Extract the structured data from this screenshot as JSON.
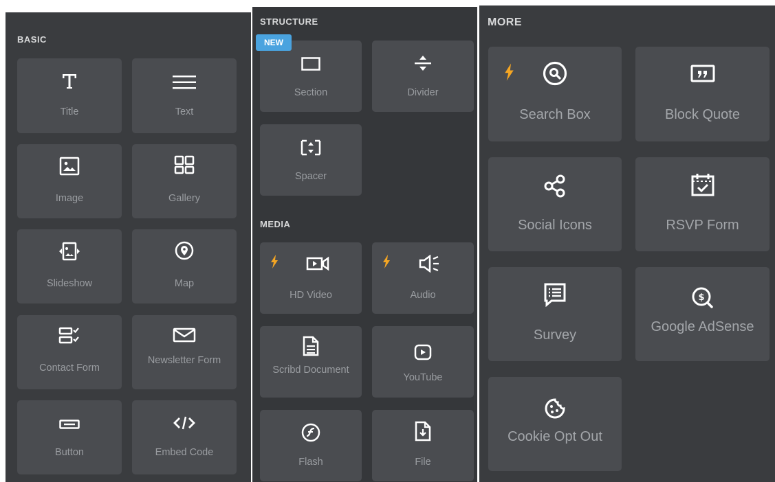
{
  "colors": {
    "panel_bg": "#3a3c3f",
    "tile_bg": "#4a4c50",
    "icon_white": "#ffffff",
    "label_gray": "#9a9da1",
    "bolt_orange": "#f5a623",
    "new_badge_blue": "#4aa3df"
  },
  "basic": {
    "title": "BASIC",
    "items": [
      {
        "label": "Title",
        "icon": "title-icon"
      },
      {
        "label": "Text",
        "icon": "text-icon"
      },
      {
        "label": "Image",
        "icon": "image-icon"
      },
      {
        "label": "Gallery",
        "icon": "gallery-icon"
      },
      {
        "label": "Slideshow",
        "icon": "slideshow-icon"
      },
      {
        "label": "Map",
        "icon": "map-pin-icon"
      },
      {
        "label": "Contact Form",
        "icon": "contact-form-icon"
      },
      {
        "label": "Newsletter Form",
        "icon": "envelope-icon"
      },
      {
        "label": "Button",
        "icon": "button-icon"
      },
      {
        "label": "Embed Code",
        "icon": "code-icon"
      }
    ]
  },
  "structure": {
    "title": "STRUCTURE",
    "new_badge": "NEW",
    "items": [
      {
        "label": "Section",
        "icon": "section-icon"
      },
      {
        "label": "Divider",
        "icon": "divider-icon"
      },
      {
        "label": "Spacer",
        "icon": "spacer-icon"
      }
    ]
  },
  "media": {
    "title": "MEDIA",
    "items": [
      {
        "label": "HD Video",
        "icon": "video-icon",
        "premium": true
      },
      {
        "label": "Audio",
        "icon": "speaker-icon",
        "premium": true
      },
      {
        "label": "Scribd Document",
        "icon": "document-icon"
      },
      {
        "label": "YouTube",
        "icon": "youtube-icon"
      },
      {
        "label": "Flash",
        "icon": "flash-icon"
      },
      {
        "label": "File",
        "icon": "file-download-icon"
      }
    ]
  },
  "more": {
    "title": "MORE",
    "items": [
      {
        "label": "Search Box",
        "icon": "search-icon",
        "premium": true
      },
      {
        "label": "Block Quote",
        "icon": "quote-icon"
      },
      {
        "label": "Social Icons",
        "icon": "share-icon"
      },
      {
        "label": "RSVP Form",
        "icon": "calendar-check-icon"
      },
      {
        "label": "Survey",
        "icon": "chat-list-icon"
      },
      {
        "label": "Google AdSense",
        "icon": "adsense-icon"
      },
      {
        "label": "Cookie Opt Out",
        "icon": "cookie-icon"
      }
    ]
  }
}
